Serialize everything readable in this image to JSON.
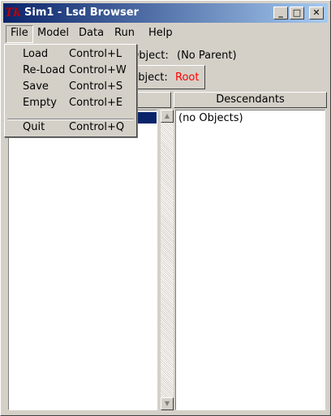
{
  "window": {
    "title": "Sim1 - Lsd Browser",
    "logo": "Tk"
  },
  "window_buttons": {
    "minimize": "_",
    "maximize": "□",
    "close": "✕"
  },
  "menubar": {
    "items": [
      "File",
      "Model",
      "Data",
      "Run",
      "Help"
    ],
    "active": "File"
  },
  "header": {
    "parent_label": "Object:",
    "parent_value": "(No Parent)",
    "object_label": "Object:",
    "object_value": "Root",
    "object_value_color": "#ff0000"
  },
  "panels": {
    "descendants_header": "Descendants",
    "descendants_empty": "(no Objects)"
  },
  "file_menu": {
    "items": [
      {
        "label": "Load",
        "accel": "Control+L"
      },
      {
        "label": "Re-Load",
        "accel": "Control+W"
      },
      {
        "label": "Save",
        "accel": "Control+S"
      },
      {
        "label": "Empty",
        "accel": "Control+E"
      },
      {
        "label": "Quit",
        "accel": "Control+Q"
      }
    ]
  },
  "colors": {
    "titlebar_start": "#0a246a",
    "titlebar_end": "#a6caf0",
    "selection": "#0a246a",
    "face": "#d4d0c8"
  }
}
